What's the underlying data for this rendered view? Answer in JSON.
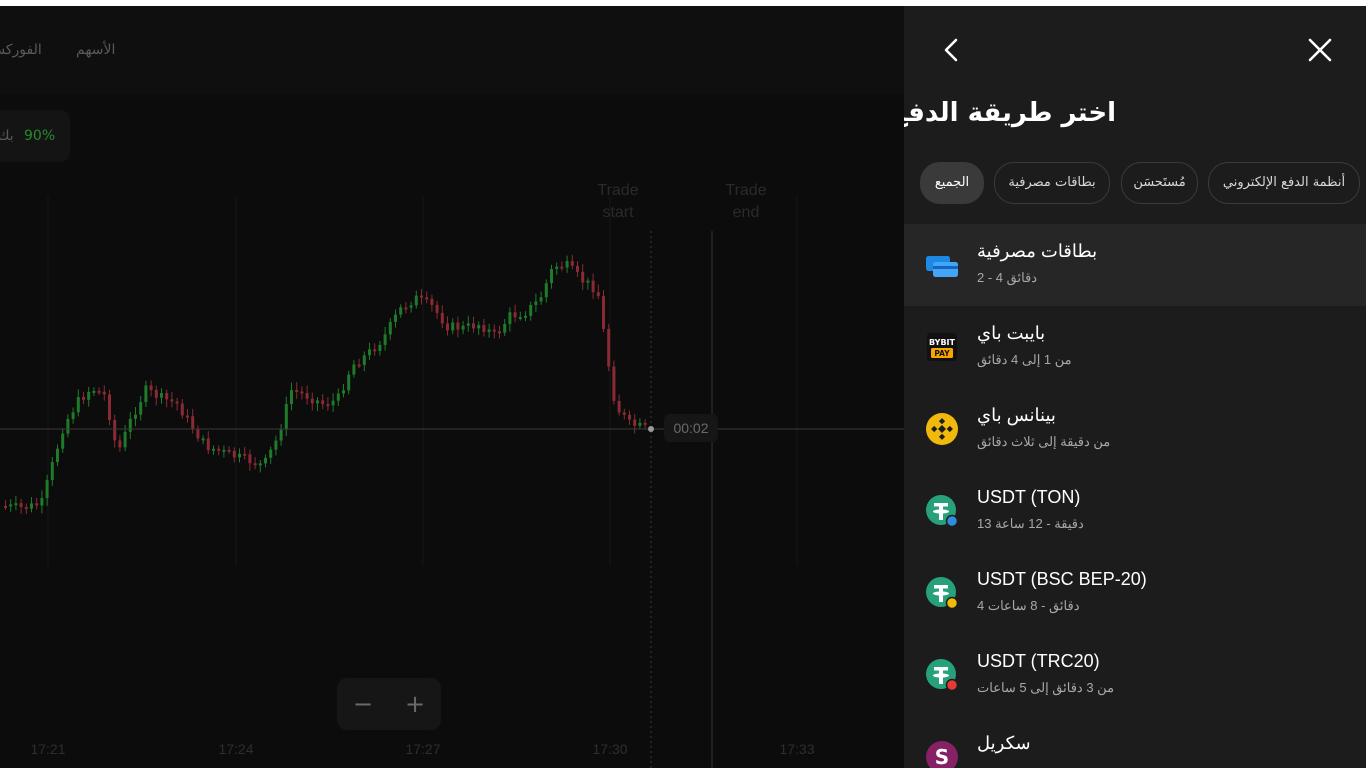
{
  "nav": {
    "items": [
      {
        "label": "الأسهم"
      },
      {
        "label": "الفوركس"
      }
    ]
  },
  "profit": {
    "percent": "90%",
    "label": "بك"
  },
  "chart_data": {
    "type": "candlestick",
    "x_ticks": [
      "17:21",
      "17:24",
      "17:27",
      "17:30",
      "17:33"
    ],
    "trade_start_label": "Trade start",
    "trade_end_label": "Trade end",
    "timer": "00:02",
    "colors": {
      "up": "#1f7a2a",
      "down": "#8a2a34"
    }
  },
  "zoom": {
    "minus": "−",
    "plus": "+"
  },
  "panel": {
    "title": "اختر طريقة الدفع",
    "tabs": [
      {
        "label": "الجميع",
        "active": true
      },
      {
        "label": "بطاقات مصرفية",
        "active": false
      },
      {
        "label": "مُستَحسَن",
        "active": false
      },
      {
        "label": "أنظمة الدفع الإلكتروني",
        "active": false
      }
    ],
    "methods": [
      {
        "name": "بطاقات مصرفية",
        "time": "2 - 4 دقائق",
        "icon": "bank-card-icon",
        "selected": true
      },
      {
        "name": "بايبت باي",
        "time": "من 1 إلى 4 دقائق",
        "icon": "bybit-pay-icon",
        "selected": false
      },
      {
        "name": "بينانس باي",
        "time": "من دقيقة إلى ثلاث دقائق",
        "icon": "binance-pay-icon",
        "selected": false
      },
      {
        "name": "USDT (TON)",
        "time": "13 دقيقة - 12 ساعة",
        "icon": "tether-ton-icon",
        "selected": false
      },
      {
        "name": "USDT (BSC BEP-20)",
        "time": "4 دقائق - 8 ساعات",
        "icon": "tether-bsc-icon",
        "selected": false
      },
      {
        "name": "USDT (TRC20)",
        "time": "من 3 دقائق إلى 5 ساعات",
        "icon": "tether-trc20-icon",
        "selected": false
      },
      {
        "name": "سكريل",
        "time": "",
        "icon": "skrill-icon",
        "selected": false
      }
    ]
  },
  "colors": {
    "accent_green": "#2a8a2a",
    "panel_bg": "#1c1c1c",
    "tether": "#26a17b",
    "binance": "#f0b90b",
    "skrill": "#862165"
  }
}
